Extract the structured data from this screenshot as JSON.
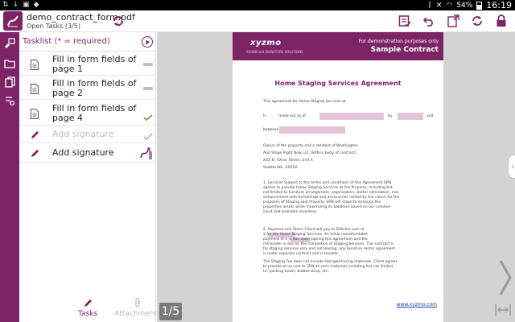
{
  "status_bar": {
    "battery": "54%",
    "time": "16:19"
  },
  "header": {
    "doc_title": "demo_contract_form.pdf",
    "subtitle": "Open Tasks (3/5)"
  },
  "tasklist": {
    "heading": "Tasklist (* = required)",
    "items": [
      {
        "label": "Fill in form fields of page 1",
        "icon": "document-icon",
        "state": "pending"
      },
      {
        "label": "Fill in form fields of page 2",
        "icon": "document-icon",
        "state": "pending"
      },
      {
        "label": "Fill in form fields of page 4",
        "icon": "document-icon",
        "state": "done"
      },
      {
        "label": "Add signature",
        "icon": "pen-icon",
        "state": "done-dim"
      },
      {
        "label": "Add signature",
        "icon": "pen-icon",
        "state": "active"
      }
    ]
  },
  "tabs": [
    {
      "label": "Tasks",
      "active": true
    },
    {
      "label": "Attachments",
      "active": false
    }
  ],
  "page_indicator": "1/5",
  "document": {
    "demo_line": "For demonstration purposes only",
    "sample_line": "Sample Contract",
    "logo": "xyzmo",
    "logo_sub": "SIGNificant SIGNATURE SOLUTIONS",
    "title": "Home Staging Services Agreement",
    "intro": "This agreement for Home Staging Services at",
    "made_is": "Is",
    "made_mid": "made   out   as   of",
    "made_by": "by",
    "made_and": "and",
    "between": "between",
    "owner1": "Owner of the property and a resident of Washington",
    "owner2": "And Stage Right Now LLC (SRN in body of contract)",
    "owner3": "XXX N. XXnd, Street, Unit X",
    "owner4": "Seattle Wa. XXXXX.",
    "services": [
      "1.  Services  Subject to the terms and conditions of this Agreement SRN",
      "agrees to provide Home Staging Services at the Property, including but",
      "not limited to furniture arrangement, organization, clutter elimination, and",
      "enhancement with furnishings and accessories rented by the client, for the",
      "purposes of Staging said Property. SRN will stage to enhance the",
      "properties assets while maximizing its liabilities based on our creative",
      "input and available inventory."
    ],
    "payment": [
      "2.  Payment and Terms  Client will pay to SRN the sum of",
      "$                      for the Home Staging Services. An initial nonrefundable",
      "payment of $               is due upon signing this agreement and the",
      "remainder is due on the completion of Staging Services. This contract is",
      "for staging services only and not leasing, any furniture rental agreement",
      "is under separate contract and is taxable."
    ],
    "fee": [
      "The Staging Fee does not include storage/moving materials. Client agrees",
      "to provide at no cost to SRN all such materials including but not limited",
      "to: packing boxes, bubble wrap, etc."
    ],
    "url": "www.xyzmo.com"
  },
  "colors": {
    "brand": "#7d2467",
    "field": "#e3c6dc",
    "viewer_bg": "#d3d3d3"
  }
}
